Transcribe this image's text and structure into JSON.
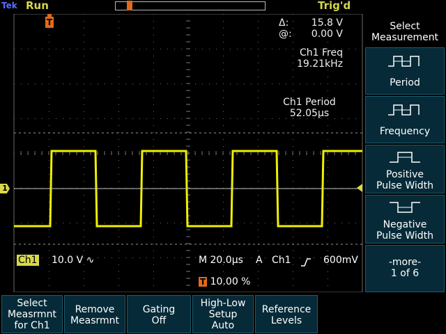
{
  "header": {
    "brand": "Tek",
    "run_state": "Run",
    "trigger_state": "Trig'd"
  },
  "readouts": {
    "cursor_delta_label": "Δ:",
    "cursor_delta_value": "15.8 V",
    "cursor_at_label": "@:",
    "cursor_at_value": "0.00 V",
    "freq_label": "Ch1 Freq",
    "freq_value": "19.21kHz",
    "period_label": "Ch1 Period",
    "period_value": "52.05µs"
  },
  "status": {
    "channel": "Ch1",
    "volts_div": "10.0 V",
    "coupling_icon": "ac-coupling-icon",
    "coupling_glyph": "∿",
    "timebase": "M 20.0µs",
    "trigger_mode": "A",
    "trigger_source": "Ch1",
    "trigger_slope_icon": "rising-edge-icon",
    "trigger_level": "600mV",
    "trigger_position_marker": "T",
    "trigger_position": "10.00 %",
    "ground_marker": "1"
  },
  "side_menu": {
    "title_line1": "Select",
    "title_line2": "Measurement",
    "items": [
      {
        "label": "Period",
        "icon": "period-waveform-icon"
      },
      {
        "label": "Frequency",
        "icon": "frequency-waveform-icon"
      },
      {
        "label_line1": "Positive",
        "label_line2": "Pulse Width",
        "icon": "positive-pulse-icon"
      },
      {
        "label_line1": "Negative",
        "label_line2": "Pulse Width",
        "icon": "negative-pulse-icon"
      }
    ],
    "more_line1": "-more-",
    "more_line2": "1 of 6"
  },
  "bottom_menu": [
    {
      "line1": "Select",
      "line2": "Measrmnt",
      "line3": "for Ch1"
    },
    {
      "line1": "Remove",
      "line2": "Measrmnt"
    },
    {
      "line1": "Gating",
      "line2": "Off"
    },
    {
      "line1": "High-Low",
      "line2": "Setup",
      "line3": "Auto"
    },
    {
      "line1": "Reference",
      "line2": "Levels"
    }
  ],
  "colors": {
    "trace": "#f0f000",
    "trigger_marker": "#e06a1c",
    "menu_bg": "#062a38",
    "grid": "#5a5a5a"
  },
  "waveform": {
    "type": "square",
    "period_divisions": 2.6,
    "high_level_div": 1.2,
    "low_level_div": -1.2
  }
}
